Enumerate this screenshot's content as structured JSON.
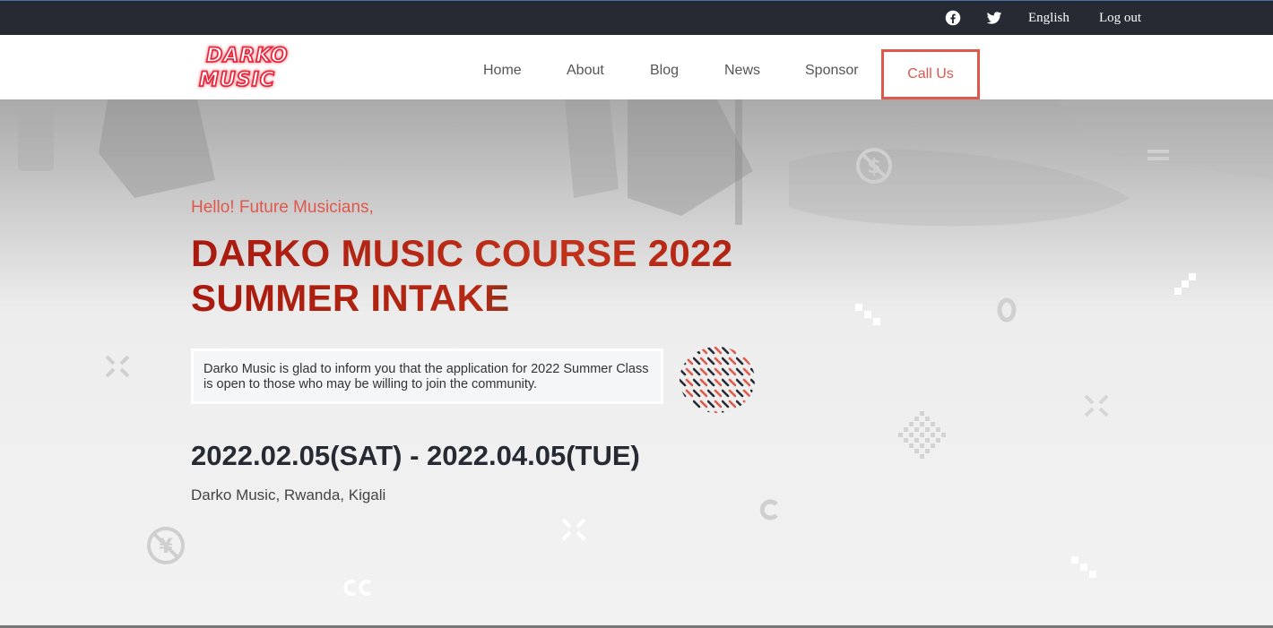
{
  "topbar": {
    "english_label": "English",
    "logout_label": "Log out",
    "icons": [
      "facebook-icon",
      "twitter-icon"
    ]
  },
  "navbar": {
    "logo_text": [
      "DARKO",
      "MUSIC"
    ],
    "links": [
      "Home",
      "About",
      "Blog",
      "News",
      "Sponsor"
    ],
    "call_us_label": "Call Us"
  },
  "hero": {
    "greeting": "Hello! Future Musicians,",
    "title_line1": "DARKO MUSIC COURSE 2022",
    "title_line2": "SUMMER INTAKE",
    "description": "Darko Music is glad to inform you that the application for 2022 Summer Class is open to those who may be willing to join the community.",
    "dates": "2022.02.05(SAT) - 2022.04.05(TUE)",
    "location": "Darko Music, Rwanda, Kigali"
  },
  "colors": {
    "accent": "#e0574b",
    "topbar_bg": "#262a33",
    "title_red": "#b41e12",
    "dark_text": "#262a33"
  }
}
